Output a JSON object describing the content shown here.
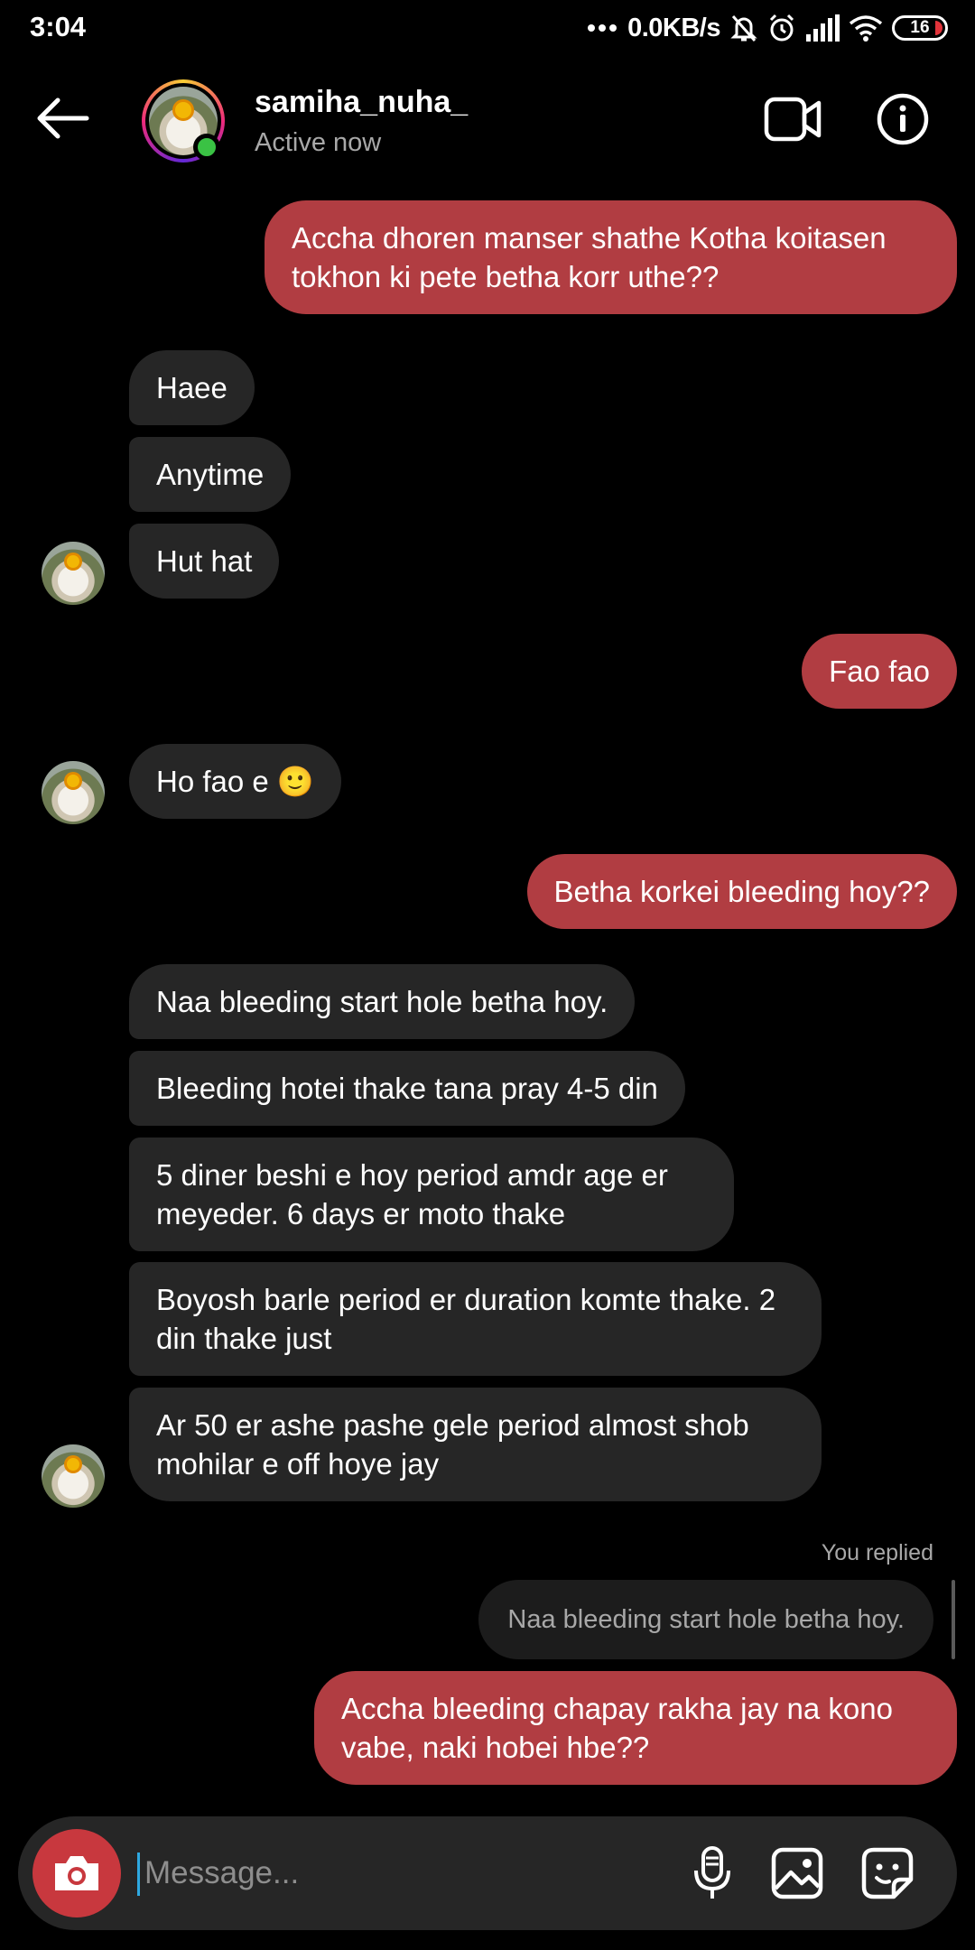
{
  "status_bar": {
    "time": "3:04",
    "net_speed": "0.0KB/s",
    "battery": "16",
    "icons": [
      "dots-icon",
      "mute-bell-icon",
      "alarm-icon",
      "signal-icon",
      "wifi-icon",
      "battery-icon"
    ]
  },
  "header": {
    "name": "samiha_nuha_",
    "status": "Active now",
    "icons": [
      "back-arrow-icon",
      "video-call-icon",
      "info-icon"
    ]
  },
  "messages": [
    {
      "dir": "out",
      "text": "Accha dhoren manser shathe Kotha koitasen tokhon ki pete betha korr uthe??"
    },
    {
      "dir": "in",
      "text": "Haee"
    },
    {
      "dir": "in",
      "text": "Anytime"
    },
    {
      "dir": "in",
      "text": "Hut hat"
    },
    {
      "dir": "out",
      "text": "Fao fao"
    },
    {
      "dir": "in",
      "text": "Ho fao e 🙂"
    },
    {
      "dir": "out",
      "text": "Betha korkei bleeding hoy??"
    },
    {
      "dir": "in",
      "text": "Naa bleeding start hole betha hoy."
    },
    {
      "dir": "in",
      "text": "Bleeding hotei thake tana pray 4-5 din"
    },
    {
      "dir": "in",
      "text": "5 diner beshi e hoy period amdr age er meyeder. 6 days er moto thake"
    },
    {
      "dir": "in",
      "text": "Boyosh barle period er duration komte thake. 2 din thake just"
    },
    {
      "dir": "in",
      "text": "Ar 50 er ashe pashe gele period almost shob mohilar e off hoye jay"
    },
    {
      "dir": "out",
      "text": "Accha bleeding chapay rakha jay na kono vabe, naki hobei hbe??"
    }
  ],
  "reply": {
    "label": "You replied",
    "quoted_text": "Naa bleeding start hole betha hoy."
  },
  "composer": {
    "placeholder": "Message...",
    "value": "",
    "icons": [
      "camera-icon",
      "microphone-icon",
      "gallery-icon",
      "sticker-icon"
    ]
  },
  "colors": {
    "outgoing_bubble": "#b13d42",
    "incoming_bubble": "#262626",
    "online": "#3ac244",
    "camera_button": "#c8383e"
  }
}
